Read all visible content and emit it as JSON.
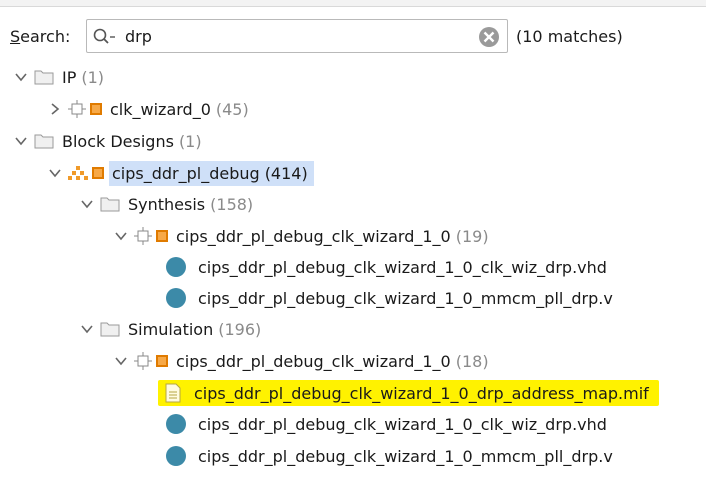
{
  "search": {
    "label_prefix": "S",
    "label_rest": "earch:",
    "value": "drp",
    "matches": "(10 matches)"
  },
  "tree": {
    "ip": {
      "label": "IP",
      "count": "(1)"
    },
    "clk_wizard": {
      "label": "clk_wizard_0",
      "count": "(45)"
    },
    "block_designs": {
      "label": "Block Designs",
      "count": "(1)"
    },
    "cips": {
      "label": "cips_ddr_pl_debug",
      "count": "(414)"
    },
    "synthesis": {
      "label": "Synthesis",
      "count": "(158)",
      "wizard": {
        "label": "cips_ddr_pl_debug_clk_wizard_1_0",
        "count": "(19)"
      },
      "files": [
        "cips_ddr_pl_debug_clk_wizard_1_0_clk_wiz_drp.vhd",
        "cips_ddr_pl_debug_clk_wizard_1_0_mmcm_pll_drp.v"
      ]
    },
    "simulation": {
      "label": "Simulation",
      "count": "(196)",
      "wizard": {
        "label": "cips_ddr_pl_debug_clk_wizard_1_0",
        "count": "(18)"
      },
      "files": [
        "cips_ddr_pl_debug_clk_wizard_1_0_drp_address_map.mif",
        "cips_ddr_pl_debug_clk_wizard_1_0_clk_wiz_drp.vhd",
        "cips_ddr_pl_debug_clk_wizard_1_0_mmcm_pll_drp.v"
      ]
    }
  },
  "colors": {
    "selection": "#cfe0f8",
    "highlight": "#fff200",
    "file_dot": "#3c8aa8",
    "ip_orange": "#e07b00"
  },
  "icons": [
    "search-icon",
    "clear-icon",
    "chevron-down-icon",
    "chevron-right-icon",
    "folder-icon",
    "ip-core-icon",
    "block-design-icon",
    "file-dot-icon",
    "document-icon"
  ]
}
